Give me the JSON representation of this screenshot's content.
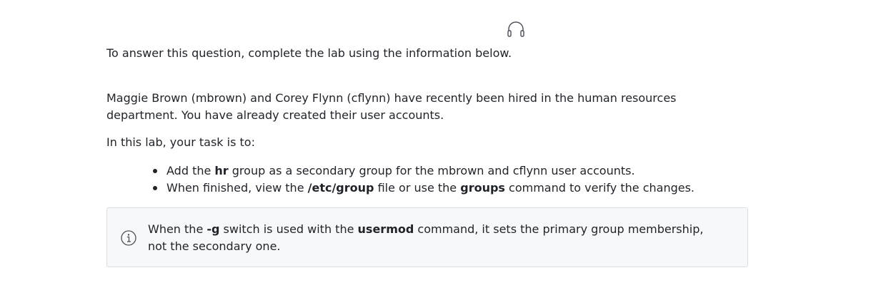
{
  "icons": {
    "top": "headphones-icon",
    "note": "info-icon"
  },
  "intro": "To answer this question, complete the lab using the information below.",
  "scenario": "Maggie Brown (mbrown) and Corey Flynn (cflynn) have recently been hired in the human resources department. You have already created their user accounts.",
  "task_intro": "In this lab, your task is to:",
  "tasks": [
    {
      "pre": "Add the ",
      "bold": "hr",
      "post": " group as a secondary group for the mbrown and cflynn user accounts."
    },
    {
      "pre": "When finished, view the ",
      "bold": "/etc/group",
      "mid": " file or use the ",
      "bold2": "groups",
      "post": " command to verify the changes."
    }
  ],
  "note": {
    "pre": "When the ",
    "switch": "-g",
    "mid": " switch is used with the ",
    "command": "usermod",
    "post": " command, it sets the primary group membership, not the secondary one."
  },
  "colors": {
    "text": "#1f2328",
    "note_background": "#f6f8fa",
    "note_border": "#d9dee3"
  }
}
